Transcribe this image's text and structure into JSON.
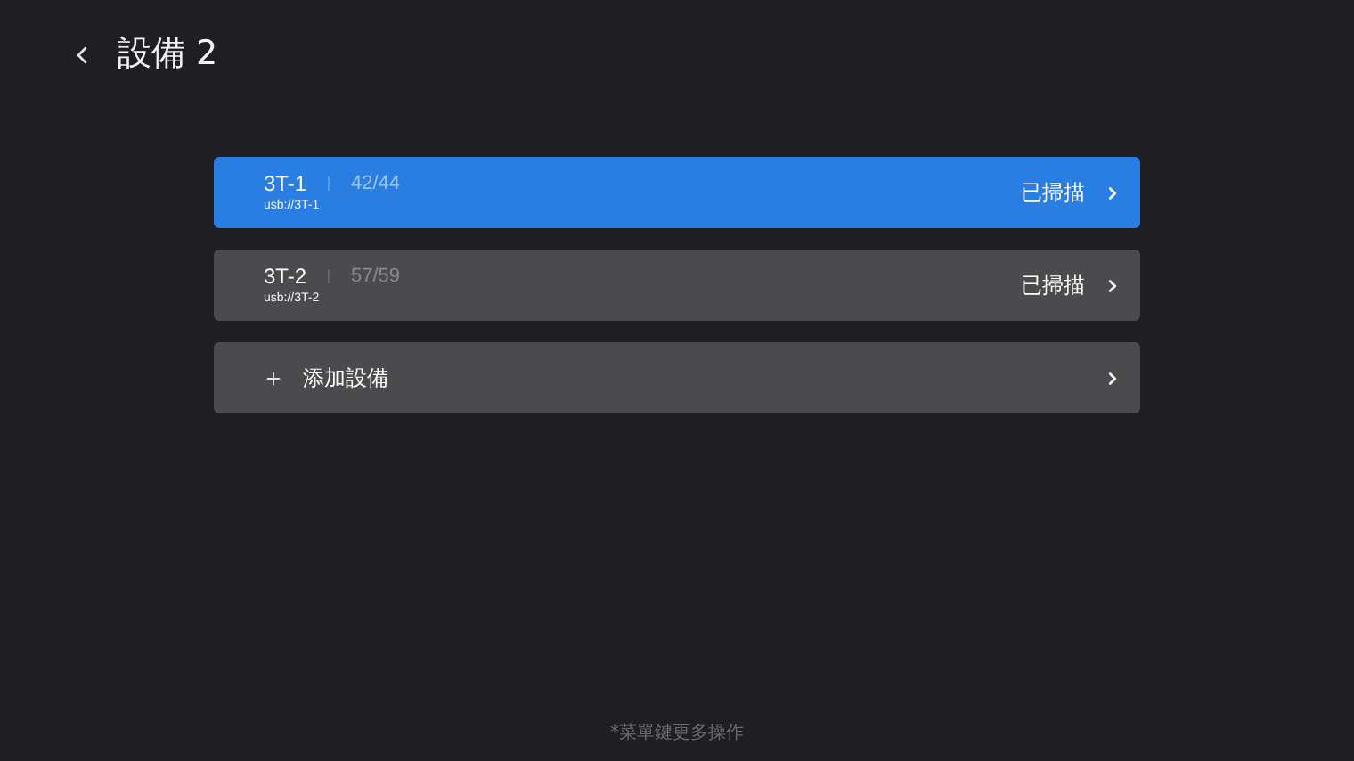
{
  "header": {
    "title": "設備 2"
  },
  "devices": [
    {
      "name": "3T-1",
      "count": "42/44",
      "path": "usb://3T-1",
      "status": "已掃描",
      "selected": true
    },
    {
      "name": "3T-2",
      "count": "57/59",
      "path": "usb://3T-2",
      "status": "已掃描",
      "selected": false
    }
  ],
  "add_device": {
    "label": "添加設備",
    "selected": false
  },
  "footer": "*菜單鍵更多操作"
}
